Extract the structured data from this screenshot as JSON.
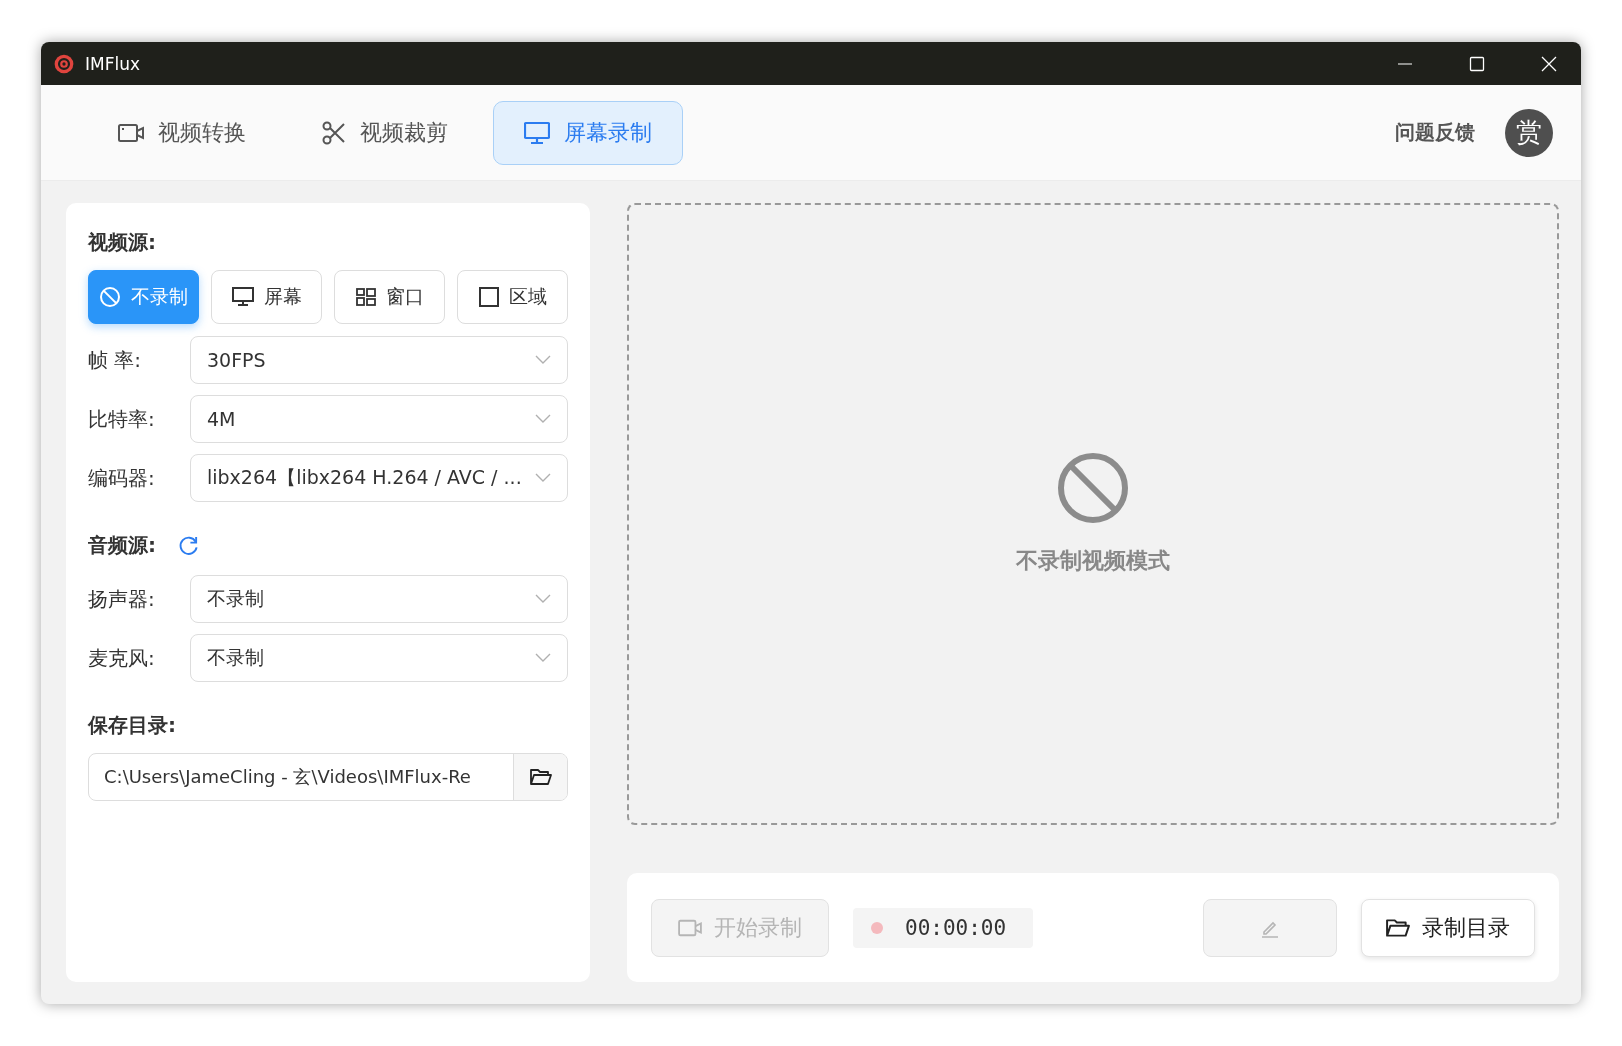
{
  "window": {
    "title": "IMFlux"
  },
  "tabs": [
    {
      "label": "视频转换",
      "kind": "video",
      "selected": false
    },
    {
      "label": "视频裁剪",
      "kind": "scissors",
      "selected": false
    },
    {
      "label": "屏幕录制",
      "kind": "monitor",
      "selected": true
    }
  ],
  "header": {
    "feedback": "问题反馈",
    "reward_avatar": "赏"
  },
  "video_source": {
    "label": "视频源:",
    "options": [
      {
        "label": "不录制",
        "kind": "none",
        "selected": true
      },
      {
        "label": "屏幕",
        "kind": "monitor",
        "selected": false
      },
      {
        "label": "窗口",
        "kind": "window",
        "selected": false
      },
      {
        "label": "区域",
        "kind": "region",
        "selected": false
      }
    ]
  },
  "video_settings": [
    {
      "label": "帧 率:",
      "value": "30FPS"
    },
    {
      "label": "比特率:",
      "value": "4M"
    },
    {
      "label": "编码器:",
      "value": "libx264【libx264 H.264 / AVC / ..."
    }
  ],
  "audio_source": {
    "label": "音频源:"
  },
  "audio_settings": [
    {
      "label": "扬声器:",
      "value": "不录制"
    },
    {
      "label": "麦克风:",
      "value": "不录制"
    }
  ],
  "save_dir": {
    "label": "保存目录:",
    "value": "C:\\Users\\JameCling - 玄\\Videos\\IMFlux-Re"
  },
  "preview": {
    "message": "不录制视频模式"
  },
  "controls": {
    "start": {
      "label": "开始录制",
      "disabled": true
    },
    "timer": "00:00:00",
    "edit": {
      "disabled": true
    },
    "open_dir": {
      "label": "录制目录"
    }
  }
}
